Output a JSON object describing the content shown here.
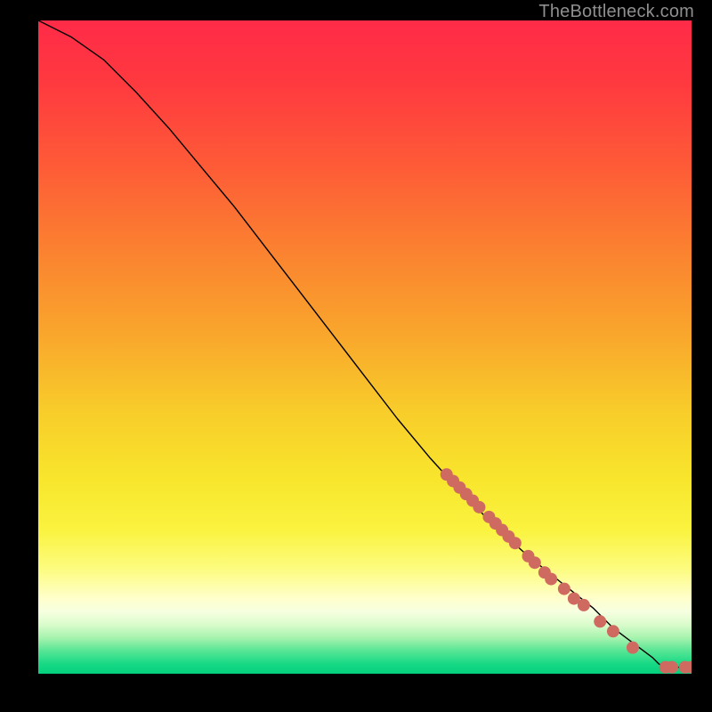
{
  "watermark": "TheBottleneck.com",
  "chart_data": {
    "type": "line",
    "title": "",
    "xlabel": "",
    "ylabel": "",
    "xlim": [
      0,
      100
    ],
    "ylim": [
      0,
      100
    ],
    "series": [
      {
        "name": "curve",
        "x": [
          0,
          5,
          10,
          15,
          20,
          25,
          30,
          35,
          40,
          45,
          50,
          55,
          60,
          65,
          70,
          75,
          80,
          85,
          88,
          90,
          92,
          94,
          95,
          96,
          98,
          100
        ],
        "y": [
          100,
          97.5,
          94,
          89,
          83.5,
          77.5,
          71.5,
          65,
          58.5,
          52,
          45.5,
          39,
          33,
          27.5,
          22.5,
          18,
          14,
          10,
          7,
          5.5,
          4,
          2.5,
          1.5,
          1,
          1,
          1
        ],
        "stroke": "#000000",
        "stroke_width": 1.4
      }
    ],
    "markers": [
      {
        "name": "dots",
        "color": "#cf6a61",
        "radius": 7,
        "points": [
          {
            "x": 62.5,
            "y": 30.5
          },
          {
            "x": 63.5,
            "y": 29.5
          },
          {
            "x": 64.5,
            "y": 28.5
          },
          {
            "x": 65.5,
            "y": 27.5
          },
          {
            "x": 66.5,
            "y": 26.5
          },
          {
            "x": 67.5,
            "y": 25.5
          },
          {
            "x": 69.0,
            "y": 24.0
          },
          {
            "x": 70.0,
            "y": 23.0
          },
          {
            "x": 71.0,
            "y": 22.0
          },
          {
            "x": 72.0,
            "y": 21.0
          },
          {
            "x": 73.0,
            "y": 20.0
          },
          {
            "x": 75.0,
            "y": 18.0
          },
          {
            "x": 76.0,
            "y": 17.0
          },
          {
            "x": 77.5,
            "y": 15.5
          },
          {
            "x": 78.5,
            "y": 14.5
          },
          {
            "x": 80.5,
            "y": 13.0
          },
          {
            "x": 82.0,
            "y": 11.5
          },
          {
            "x": 83.5,
            "y": 10.5
          },
          {
            "x": 86.0,
            "y": 8.0
          },
          {
            "x": 88.0,
            "y": 6.5
          },
          {
            "x": 91.0,
            "y": 4.0
          },
          {
            "x": 96.0,
            "y": 1.0
          },
          {
            "x": 97.0,
            "y": 1.0
          },
          {
            "x": 99.0,
            "y": 1.0
          },
          {
            "x": 100.0,
            "y": 1.0
          }
        ]
      }
    ],
    "background_gradient": {
      "stops": [
        {
          "offset": 0.0,
          "color": "#ff2b48"
        },
        {
          "offset": 0.1,
          "color": "#ff3a3f"
        },
        {
          "offset": 0.22,
          "color": "#fe5a37"
        },
        {
          "offset": 0.35,
          "color": "#fb8130"
        },
        {
          "offset": 0.48,
          "color": "#f9a62c"
        },
        {
          "offset": 0.6,
          "color": "#f8cd2a"
        },
        {
          "offset": 0.7,
          "color": "#f8e52c"
        },
        {
          "offset": 0.78,
          "color": "#faf33f"
        },
        {
          "offset": 0.84,
          "color": "#fdfc80"
        },
        {
          "offset": 0.885,
          "color": "#ffffcc"
        },
        {
          "offset": 0.905,
          "color": "#f6ffe0"
        },
        {
          "offset": 0.925,
          "color": "#d9fccb"
        },
        {
          "offset": 0.945,
          "color": "#a6f3ae"
        },
        {
          "offset": 0.965,
          "color": "#57e595"
        },
        {
          "offset": 0.985,
          "color": "#17d985"
        },
        {
          "offset": 1.0,
          "color": "#04d07e"
        }
      ]
    }
  }
}
